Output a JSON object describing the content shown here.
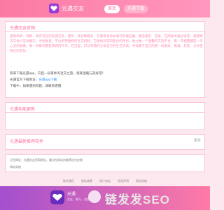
{
  "header": {
    "brand": "光遇交友",
    "nav_home": "首页",
    "nav_download": "光遇下载"
  },
  "official": {
    "title": "光遇交友官网",
    "paragraph": "提供简单、纯粹、真实可信的同城交友、相亲、找对象服务，方便单身男女进行同城征婚、婚恋相亲、恋爱、在网站中通过语音、视频聊天与他人互动聊天，寻找真爱。平台采用独特的社交机制，方便找到志同道合的伴侣，致力做一个温馨的交流平台。每一次相遇都是一次心灵的碰撞，每一次聊天都是情感的升华。在这里，可以尽情的分享自己的生活点滴，寻找属于自己的那一份美好。真诚、友善、分享是我们的宗旨。",
    "line_download_prompt": "快来下载光遇app，开启一段奇妙的社交之旅，感受温暖与美好吧！",
    "line_download_label": "光遇官方下载地址：",
    "line_download_link": "光遇app下载",
    "line_download_tip": "下载中，如果遇到问题，请联系客服"
  },
  "update": {
    "title": "光遇功能更新"
  },
  "recommend": {
    "title": "光遇最新推荐软件",
    "more": "更多"
  },
  "disclaimer": {
    "line1": "记住网址：光遇交友官网地址，重点在网站内推荐优先安装",
    "line2": "网站导航"
  },
  "footer_nav": [
    "联系我们",
    "隐私政策",
    "用户协议",
    "免责声明",
    "网站导航"
  ],
  "bottom": {
    "title": "光遇",
    "subtitle": "交友、聊天、恋爱",
    "watermark": "链发发SEO"
  },
  "colors": {
    "accent": "#ff6fa0",
    "header_gradient_start": "#fb7aa3",
    "bottom_gradient_start": "#a34fcf"
  }
}
